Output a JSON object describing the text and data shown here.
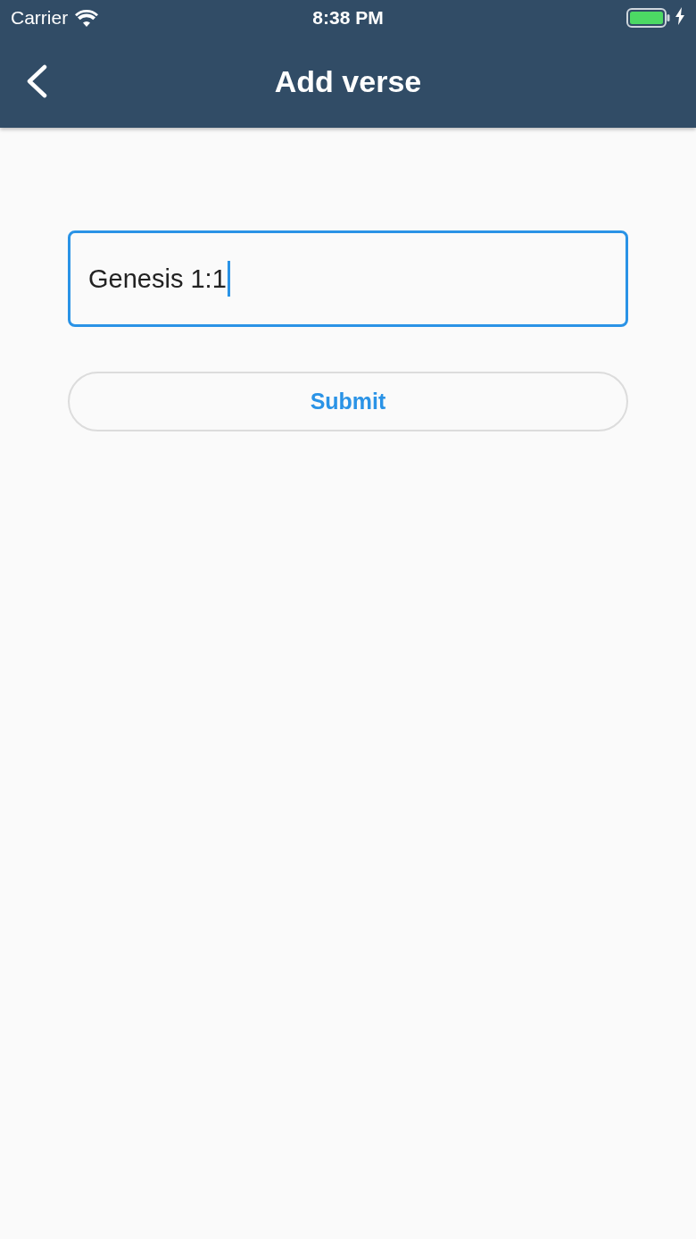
{
  "status_bar": {
    "carrier": "Carrier",
    "time": "8:38 PM",
    "charging": true
  },
  "header": {
    "title": "Add verse"
  },
  "form": {
    "verse_field": {
      "value": "Genesis 1:1",
      "focused": true
    },
    "submit_button": {
      "label": "Submit"
    }
  }
}
